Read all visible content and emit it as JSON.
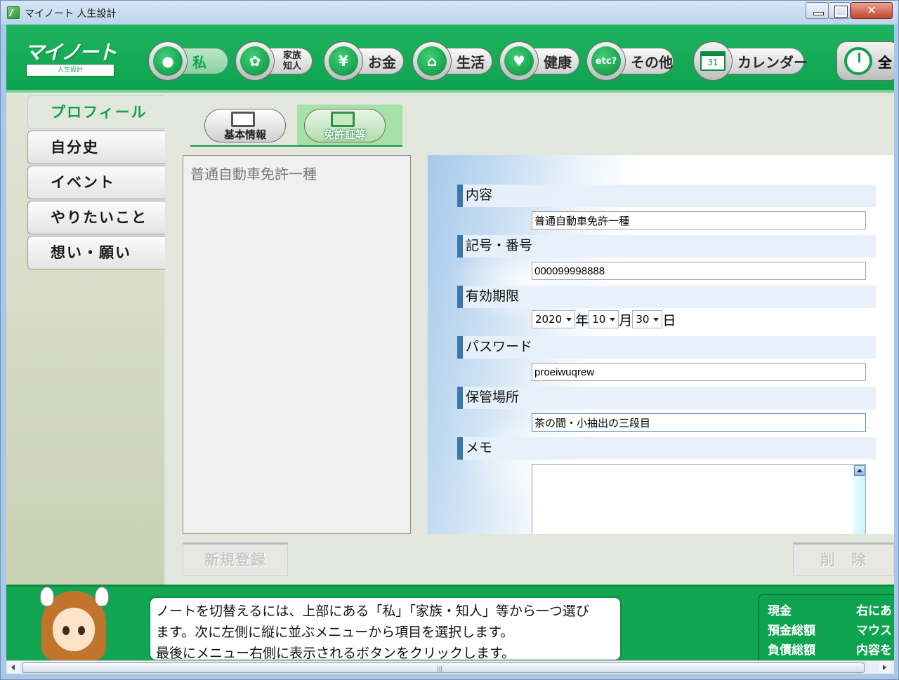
{
  "window": {
    "title": "マイノート 人生設計"
  },
  "logo": {
    "main": "マイノート",
    "sub": "人生設計"
  },
  "nav": [
    {
      "icon": "person-icon",
      "label": "私",
      "active": true
    },
    {
      "icon": "family-icon",
      "label_line1": "家族",
      "label_line2": "知人"
    },
    {
      "icon": "yen-icon",
      "label": "お金"
    },
    {
      "icon": "house-icon",
      "label": "生活"
    },
    {
      "icon": "heart-icon",
      "label": "健康"
    },
    {
      "icon": "etc-question-icon",
      "label": "その他",
      "icon_text": "etc?"
    },
    {
      "icon": "calendar-icon",
      "label": "カレンダー",
      "icon_text": "31"
    },
    {
      "icon": "clock-icon",
      "label": "全"
    }
  ],
  "sidebar": {
    "items": [
      {
        "label": "プロフィール",
        "active": true
      },
      {
        "label": "自分史"
      },
      {
        "label": "イベント"
      },
      {
        "label": "やりたいこと"
      },
      {
        "label": "想い・願い"
      }
    ]
  },
  "tabs": [
    {
      "label": "基本情報"
    },
    {
      "label": "免許証等",
      "active": true
    }
  ],
  "list": {
    "items": [
      "普通自動車免許一種"
    ]
  },
  "form": {
    "content": {
      "label": "内容",
      "value": "普通自動車免許一種"
    },
    "number": {
      "label": "記号・番号",
      "value": "000099998888"
    },
    "expiry": {
      "label": "有効期限",
      "year": "2020",
      "year_unit": "年",
      "month": "10",
      "month_unit": "月",
      "day": "30",
      "day_unit": "日"
    },
    "password": {
      "label": "パスワード",
      "value": "proeiwuqrew"
    },
    "location": {
      "label": "保管場所",
      "value": "茶の間・小抽出の三段目"
    },
    "memo": {
      "label": "メモ",
      "value": ""
    }
  },
  "buttons": {
    "new": "新規登録",
    "delete": "削　除"
  },
  "help": {
    "line1": "ノートを切替えるには、上部にある「私」「家族・知人」等から一つ選び",
    "line2": "ます。次に左側に縦に並ぶメニューから項目を選択します。",
    "line3": "最後にメニュー右側に表示されるボタンをクリックします。"
  },
  "summary": {
    "cash_label": "現金",
    "deposit_label": "預金総額",
    "debt_label": "負債総額",
    "note1": "右にあ",
    "note2": "マウス",
    "note3": "内容を"
  },
  "colors": {
    "accent": "#0ea34f",
    "header_bar": "#3a77ae"
  }
}
